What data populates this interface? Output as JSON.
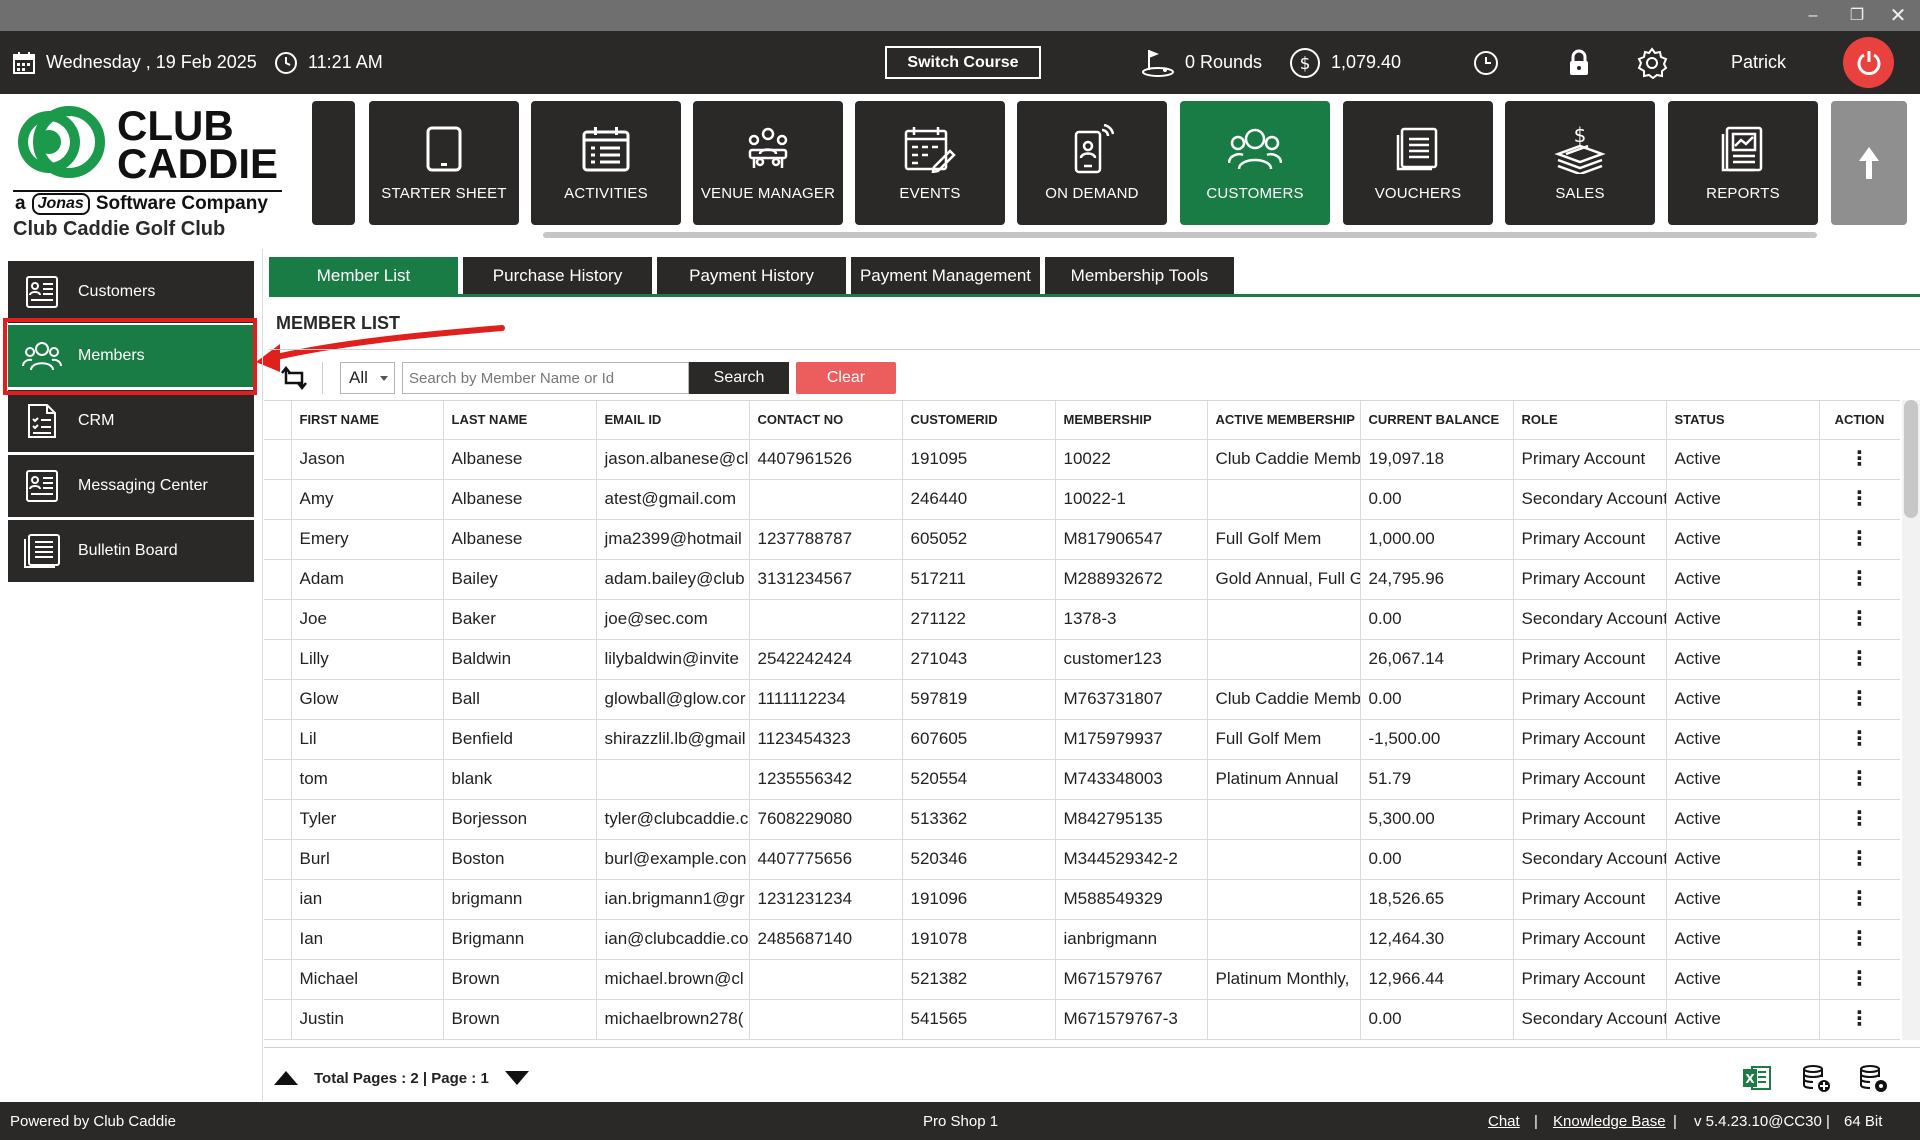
{
  "topbar": {
    "date": "Wednesday ,  19 Feb 2025",
    "time": "11:21 AM",
    "switch_course": "Switch Course",
    "rounds": "0 Rounds",
    "balance": "1,079.40",
    "user": "Patrick"
  },
  "brand": {
    "logo_line1": "CLUB",
    "logo_line2": "CADDIE",
    "logo_tag_a": "a",
    "logo_tag_jonas": "Jonas",
    "logo_tag_rest": "Software Company",
    "club_name": "Club Caddie Golf Club"
  },
  "modules": [
    {
      "label": "STARTER SHEET",
      "icon": "tablet-icon"
    },
    {
      "label": "ACTIVITIES",
      "icon": "checklist-icon"
    },
    {
      "label": "VENUE MANAGER",
      "icon": "meeting-icon"
    },
    {
      "label": "EVENTS",
      "icon": "calendar-edit-icon"
    },
    {
      "label": "ON DEMAND",
      "icon": "phone-person-icon"
    },
    {
      "label": "CUSTOMERS",
      "icon": "users-icon"
    },
    {
      "label": "VOUCHERS",
      "icon": "voucher-icon"
    },
    {
      "label": "SALES",
      "icon": "cash-icon"
    },
    {
      "label": "REPORTS",
      "icon": "report-icon"
    }
  ],
  "sidebar": {
    "items": [
      {
        "label": "Customers"
      },
      {
        "label": "Members"
      },
      {
        "label": "CRM"
      },
      {
        "label": "Messaging Center"
      },
      {
        "label": "Bulletin Board"
      }
    ]
  },
  "tabs": [
    {
      "label": "Member List"
    },
    {
      "label": "Purchase History"
    },
    {
      "label": "Payment History"
    },
    {
      "label": "Payment Management"
    },
    {
      "label": "Membership Tools"
    }
  ],
  "section_title": "MEMBER LIST",
  "search": {
    "filter_value": "All",
    "placeholder": "Search by Member Name or Id",
    "search_label": "Search",
    "clear_label": "Clear"
  },
  "table": {
    "columns": [
      "FIRST NAME",
      "LAST NAME",
      "EMAIL ID",
      "CONTACT NO",
      "CUSTOMERID",
      "MEMBERSHIP",
      "ACTIVE MEMBERSHIP",
      "CURRENT BALANCE",
      "ROLE",
      "STATUS",
      "ACTION"
    ],
    "rows": [
      [
        "Jason",
        "Albanese",
        "jason.albanese@cl",
        "4407961526",
        "191095",
        "10022",
        "Club Caddie Memb",
        "19,097.18",
        "Primary Account",
        "Active"
      ],
      [
        "Amy",
        "Albanese",
        "atest@gmail.com",
        "",
        "246440",
        "10022-1",
        "",
        "0.00",
        "Secondary Account",
        "Active"
      ],
      [
        "Emery",
        "Albanese",
        "jma2399@hotmail",
        "1237788787",
        "605052",
        "M817906547",
        "Full Golf Mem",
        "1,000.00",
        "Primary Account",
        "Active"
      ],
      [
        "Adam",
        "Bailey",
        "adam.bailey@club",
        "3131234567",
        "517211",
        "M288932672",
        "Gold Annual, Full G",
        "24,795.96",
        "Primary Account",
        "Active"
      ],
      [
        "Joe",
        "Baker",
        "joe@sec.com",
        "",
        "271122",
        "1378-3",
        "",
        "0.00",
        "Secondary Account",
        "Active"
      ],
      [
        "Lilly",
        "Baldwin",
        "lilybaldwin@invite",
        "2542242424",
        "271043",
        "customer123",
        "",
        "26,067.14",
        "Primary Account",
        "Active"
      ],
      [
        "Glow",
        "Ball",
        "glowball@glow.cor",
        "1111112234",
        "597819",
        "M763731807",
        "Club Caddie Memb",
        "0.00",
        "Primary Account",
        "Active"
      ],
      [
        "Lil",
        "Benfield",
        "shirazzlil.lb@gmail",
        "1123454323",
        "607605",
        "M175979937",
        "Full Golf Mem",
        "-1,500.00",
        "Primary Account",
        "Active"
      ],
      [
        "tom",
        "blank",
        "",
        "1235556342",
        "520554",
        "M743348003",
        "Platinum Annual",
        "51.79",
        "Primary Account",
        "Active"
      ],
      [
        "Tyler",
        "Borjesson",
        "tyler@clubcaddie.c",
        "7608229080",
        "513362",
        "M842795135",
        "",
        "5,300.00",
        "Primary Account",
        "Active"
      ],
      [
        "Burl",
        "Boston",
        "burl@example.con",
        "4407775656",
        "520346",
        "M344529342-2",
        "",
        "0.00",
        "Secondary Account",
        "Active"
      ],
      [
        "ian",
        "brigmann",
        "ian.brigmann1@gr",
        "1231231234",
        "191096",
        "M588549329",
        "",
        "18,526.65",
        "Primary Account",
        "Active"
      ],
      [
        "Ian",
        "Brigmann",
        "ian@clubcaddie.co",
        "2485687140",
        "191078",
        "ianbrigmann",
        "",
        "12,464.30",
        "Primary Account",
        "Active"
      ],
      [
        "Michael",
        "Brown",
        "michael.brown@cl",
        "",
        "521382",
        "M671579767",
        "Platinum Monthly,",
        "12,966.44",
        "Primary Account",
        "Active"
      ],
      [
        "Justin",
        "Brown",
        "michaelbrown278(",
        "",
        "541565",
        "M671579767-3",
        "",
        "0.00",
        "Secondary Account",
        "Active"
      ]
    ]
  },
  "pager": {
    "text": "Total Pages : 2 | Page : 1"
  },
  "statusbar": {
    "powered": "Powered by Club Caddie",
    "station": "Pro Shop 1",
    "chat": "Chat",
    "sep1": "|",
    "kb": "Knowledge Base",
    "sep2": "|",
    "version": "v 5.4.23.10@CC30",
    "sep3": "|",
    "bits": "64 Bit"
  },
  "colors": {
    "accent": "#1a7c45",
    "dark": "#2b2828",
    "clear": "#ec5d5d",
    "highlight": "#e0201c"
  }
}
